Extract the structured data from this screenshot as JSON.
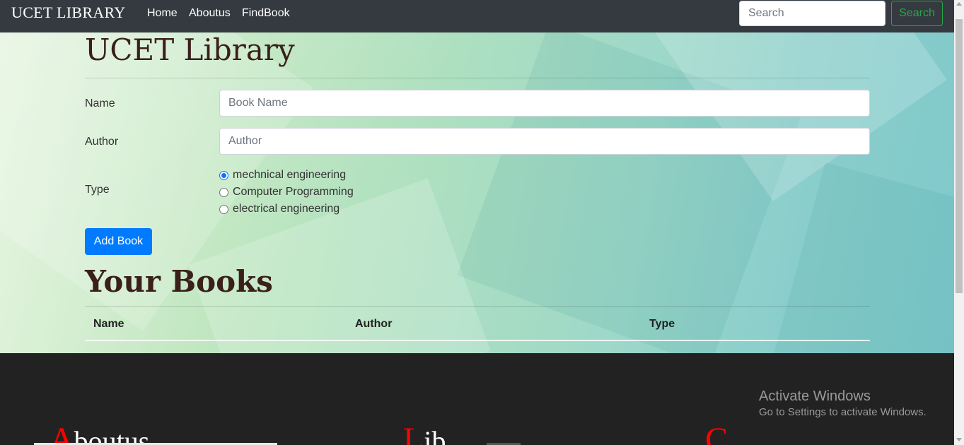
{
  "navbar": {
    "brand": "UCET LIBRARY",
    "links": [
      "Home",
      "Aboutus",
      "FindBook"
    ],
    "search_placeholder": "Search",
    "search_button": "Search"
  },
  "form": {
    "title": "UCET Library",
    "name_label": "Name",
    "name_placeholder": "Book Name",
    "author_label": "Author",
    "author_placeholder": "Author",
    "type_label": "Type",
    "type_options": [
      "mechnical engineering",
      "Computer Programming",
      "electrical engineering"
    ],
    "type_selected": "mechnical engineering",
    "submit": "Add Book"
  },
  "books": {
    "title": "Your Books",
    "columns": [
      "Name",
      "Author",
      "Type"
    ]
  },
  "footer": {
    "headings": [
      {
        "cap": "A",
        "rest": "boutus"
      },
      {
        "cap": "L",
        "rest": "ib"
      },
      {
        "cap": "C",
        "rest": ""
      }
    ]
  },
  "watermark": {
    "line1": "Activate Windows",
    "line2": "Go to Settings to activate Windows."
  },
  "colors": {
    "navbar_bg": "#343a40",
    "primary": "#007bff",
    "success": "#28a745",
    "footer_bg": "#222222",
    "accent_red": "#ff0000"
  }
}
